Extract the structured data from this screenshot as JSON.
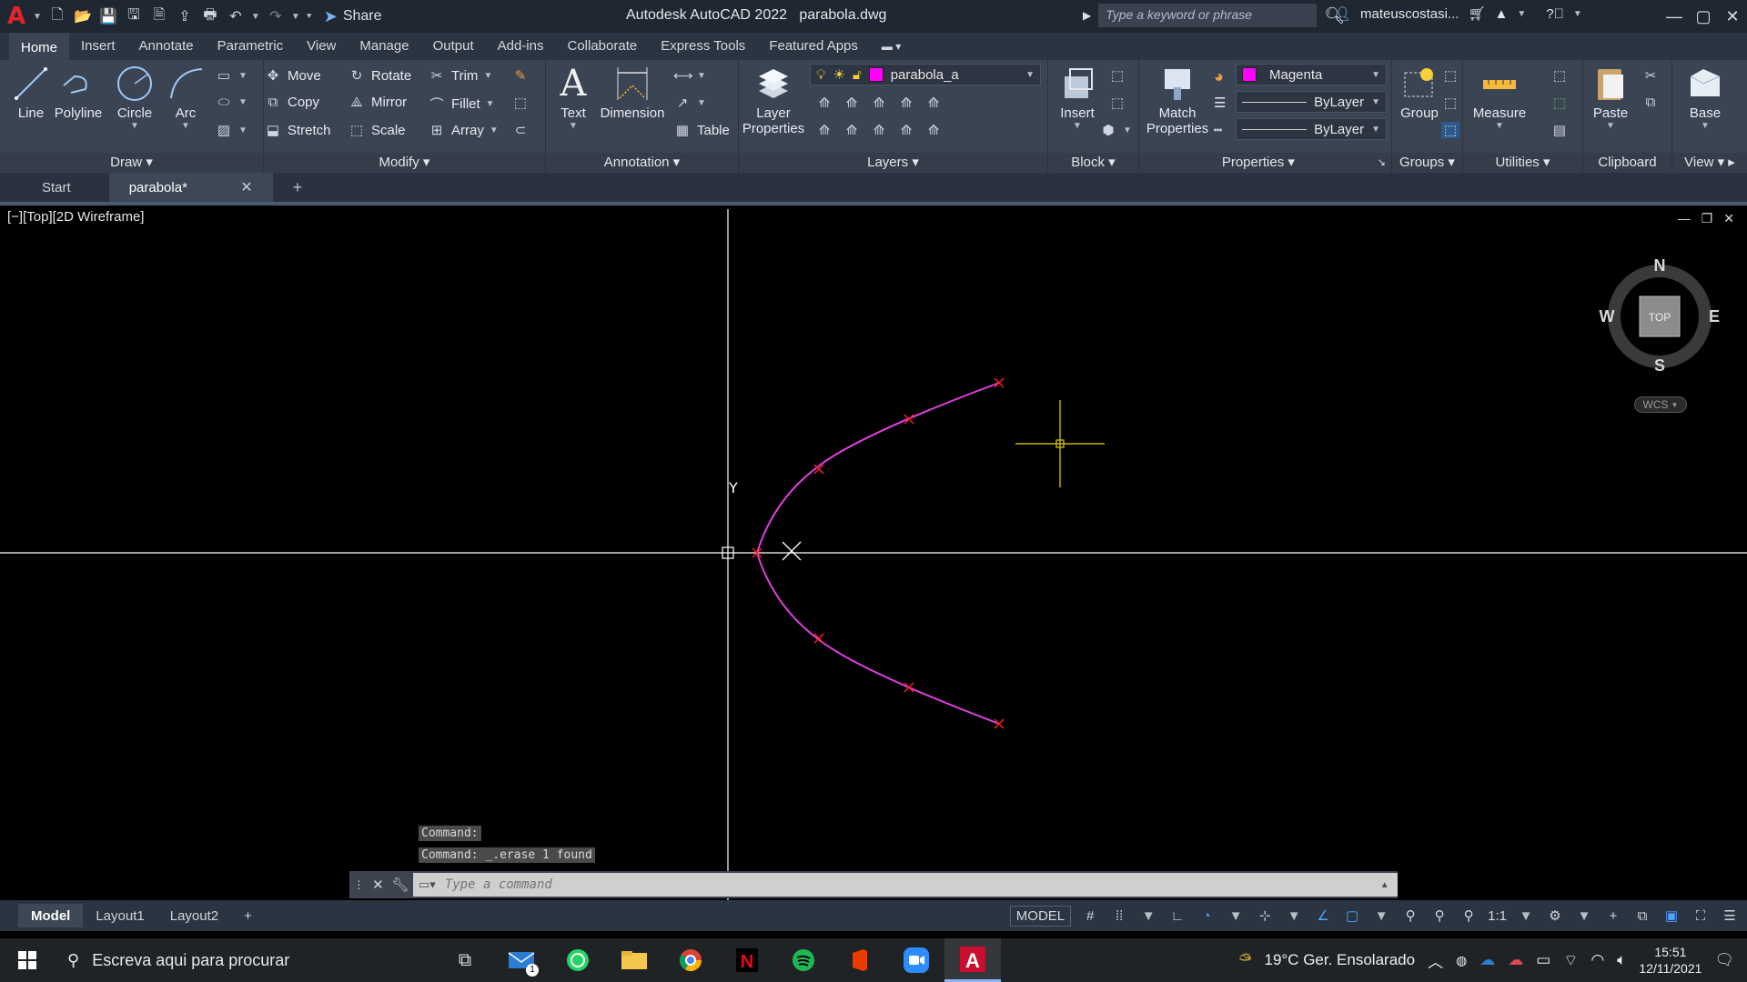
{
  "titlebar": {
    "app_title": "Autodesk AutoCAD 2022",
    "file_title": "parabola.dwg",
    "share_label": "Share",
    "search_placeholder": "Type a keyword or phrase",
    "user_name": "mateuscostasi..."
  },
  "ribbon_tabs": [
    "Home",
    "Insert",
    "Annotate",
    "Parametric",
    "View",
    "Manage",
    "Output",
    "Add-ins",
    "Collaborate",
    "Express Tools",
    "Featured Apps"
  ],
  "ribbon": {
    "draw": {
      "title": "Draw",
      "line": "Line",
      "polyline": "Polyline",
      "circle": "Circle",
      "arc": "Arc"
    },
    "modify": {
      "title": "Modify",
      "move": "Move",
      "rotate": "Rotate",
      "trim": "Trim",
      "copy": "Copy",
      "mirror": "Mirror",
      "fillet": "Fillet",
      "stretch": "Stretch",
      "scale": "Scale",
      "array": "Array"
    },
    "annotation": {
      "title": "Annotation",
      "text": "Text",
      "dimension": "Dimension",
      "table": "Table"
    },
    "layers": {
      "title": "Layers",
      "layer_properties": "Layer Properties",
      "current_layer": "parabola_a",
      "layer_color": "#ff00ff"
    },
    "block": {
      "title": "Block",
      "insert": "Insert"
    },
    "properties": {
      "title": "Properties",
      "match": "Match Properties",
      "color": "Magenta",
      "linetype": "ByLayer",
      "lineweight": "ByLayer"
    },
    "groups": {
      "title": "Groups",
      "group": "Group"
    },
    "utilities": {
      "title": "Utilities",
      "measure": "Measure"
    },
    "clipboard": {
      "title": "Clipboard",
      "paste": "Paste"
    },
    "view": {
      "title": "View",
      "base": "Base"
    }
  },
  "file_tabs": {
    "start": "Start",
    "active": "parabola*"
  },
  "viewport": {
    "label": "[−][Top][2D Wireframe]",
    "viewcube": {
      "north": "N",
      "south": "S",
      "east": "E",
      "west": "W",
      "face": "TOP",
      "wcs": "WCS"
    },
    "ucs_y": "Y"
  },
  "command": {
    "history": [
      "Command:",
      "Command: _.erase 1 found"
    ],
    "placeholder": "Type a command"
  },
  "layout_tabs": [
    "Model",
    "Layout1",
    "Layout2"
  ],
  "status": {
    "mode": "MODEL",
    "scale": "1:1"
  },
  "taskbar": {
    "search_placeholder": "Escreva aqui para procurar",
    "weather": "19°C  Ger. Ensolarado",
    "time": "15:51",
    "date": "12/11/2021",
    "mail_badge": "1"
  },
  "colors": {
    "curve": "#e040e0",
    "markers": "#ff2222",
    "crosshair": "#c9b400",
    "axis": "#ffffff",
    "ribbon": "#3b4453",
    "accent": "#52a2ff"
  }
}
